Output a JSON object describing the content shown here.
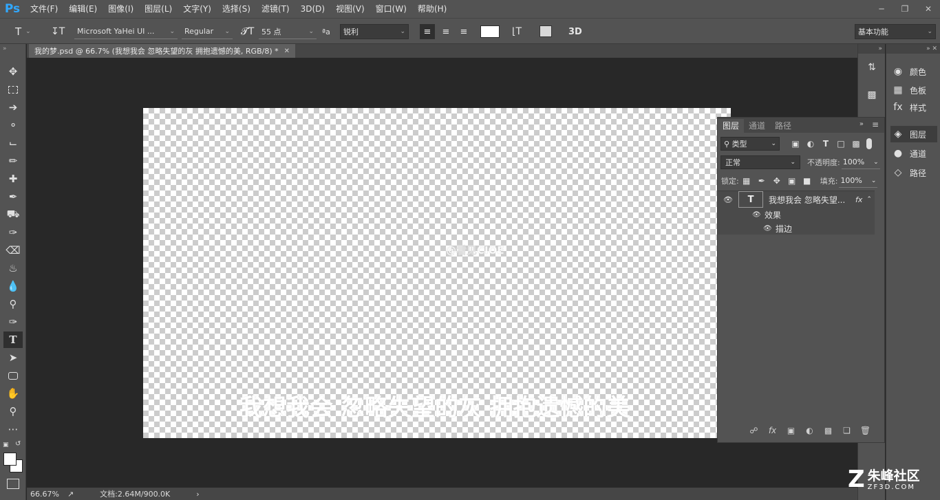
{
  "app": {
    "logo": "Ps"
  },
  "menu": [
    "文件(F)",
    "编辑(E)",
    "图像(I)",
    "图层(L)",
    "文字(Y)",
    "选择(S)",
    "滤镜(T)",
    "3D(D)",
    "视图(V)",
    "窗口(W)",
    "帮助(H)"
  ],
  "options": {
    "font_family": "Microsoft YaHei UI ...",
    "font_style": "Regular",
    "font_size": "55 点",
    "aa_label": "ªa",
    "antialias": "锐利",
    "threed": "3D",
    "workspace": "基本功能"
  },
  "document": {
    "tab_title": "我的梦.psd @ 66.7% (我想我会 忽略失望的灰 拥抱遗憾的美, RGB/8) *",
    "canvas_watermark": "@看见CIOE",
    "canvas_text": "我想我会 忽略失望的灰 拥抱遗憾的美"
  },
  "status": {
    "zoom": "66.67%",
    "doc": "文档:2.64M/900.0K",
    "arrow": "›"
  },
  "side_panels": [
    "颜色",
    "色板",
    "样式",
    "图层",
    "通道",
    "路径"
  ],
  "layers": {
    "tabs": [
      "图层",
      "通道",
      "路径"
    ],
    "filter_kind": "类型",
    "blend_mode": "正常",
    "opacity_label": "不透明度:",
    "opacity": "100%",
    "lock_label": "锁定:",
    "fill_label": "填充:",
    "fill": "100%",
    "items": [
      {
        "name": "我想我会 忽略失望...",
        "fx": "fx"
      },
      {
        "name": "效果"
      },
      {
        "name": "描边"
      }
    ]
  },
  "brand": {
    "cn": "朱峰社区",
    "en": "ZF3D.COM"
  },
  "colors": {
    "accent": "#31a8ff",
    "panel": "#535353",
    "canvas_bg": "#282828"
  }
}
